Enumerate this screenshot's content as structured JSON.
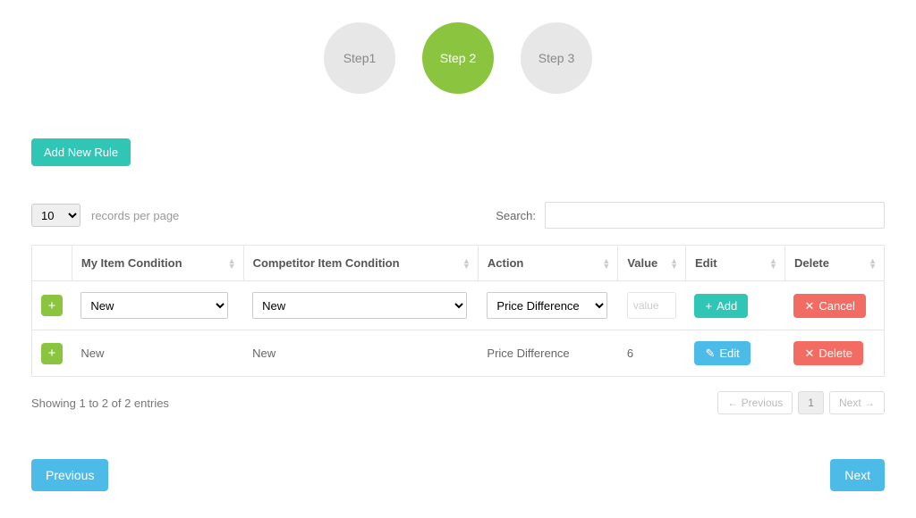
{
  "steps": {
    "s1": "Step1",
    "s2": "Step 2",
    "s3": "Step 3",
    "active": 2
  },
  "add_rule_btn": "Add New Rule",
  "length": {
    "value": "10",
    "suffix": "records per page"
  },
  "search": {
    "label": "Search:",
    "value": ""
  },
  "headers": {
    "expand": "",
    "my_cond": "My Item Condition",
    "comp_cond": "Competitor Item Condition",
    "action": "Action",
    "value": "Value",
    "edit": "Edit",
    "delete": "Delete"
  },
  "row_add": {
    "my_cond_sel": "New",
    "comp_cond_sel": "New",
    "action_sel": "Price Difference",
    "value_placeholder": "value",
    "add_btn": "Add",
    "cancel_btn": "Cancel"
  },
  "rows": [
    {
      "my_cond": "New",
      "comp_cond": "New",
      "action": "Price Difference",
      "value": "6"
    }
  ],
  "row_btn": {
    "edit": "Edit",
    "delete": "Delete"
  },
  "info": "Showing 1 to 2 of 2 entries",
  "pager": {
    "prev": "← Previous",
    "page": "1",
    "next": "Next →"
  },
  "nav": {
    "prev": "Previous",
    "next": "Next"
  }
}
